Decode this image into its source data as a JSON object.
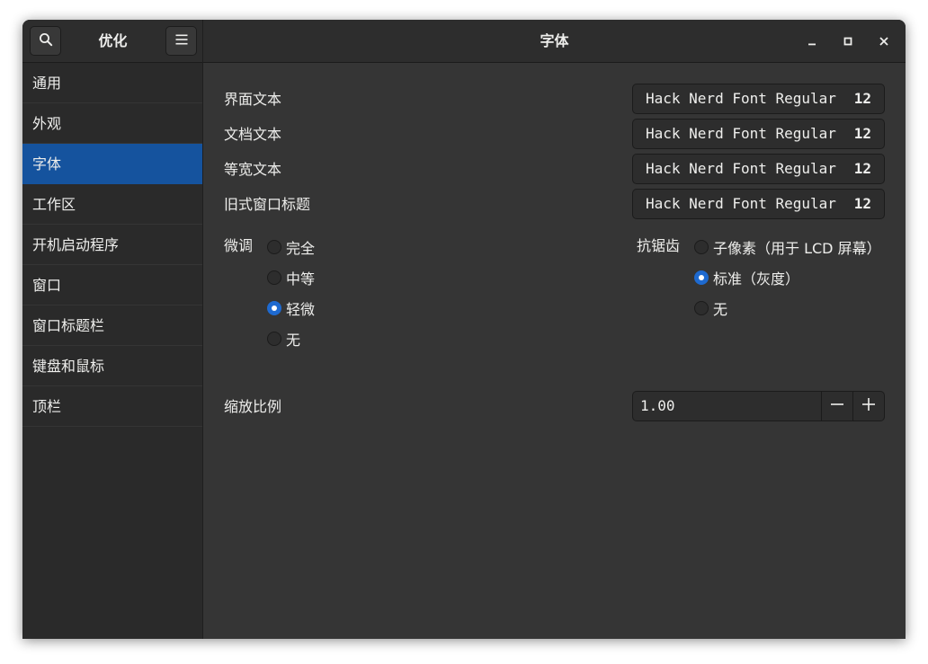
{
  "header": {
    "sidebar_title": "优化",
    "window_title": "字体"
  },
  "sidebar": {
    "items": [
      {
        "label": "通用"
      },
      {
        "label": "外观"
      },
      {
        "label": "字体",
        "selected": true
      },
      {
        "label": "工作区"
      },
      {
        "label": "开机启动程序"
      },
      {
        "label": "窗口"
      },
      {
        "label": "窗口标题栏"
      },
      {
        "label": "键盘和鼠标"
      },
      {
        "label": "顶栏"
      }
    ]
  },
  "fonts": [
    {
      "label": "界面文本",
      "font": "Hack Nerd Font Regular",
      "size": "12"
    },
    {
      "label": "文档文本",
      "font": "Hack Nerd Font Regular",
      "size": "12"
    },
    {
      "label": "等宽文本",
      "font": "Hack Nerd Font Regular",
      "size": "12"
    },
    {
      "label": "旧式窗口标题",
      "font": "Hack Nerd Font Regular",
      "size": "12"
    }
  ],
  "hinting": {
    "label": "微调",
    "options": [
      "完全",
      "中等",
      "轻微",
      "无"
    ],
    "selected": "轻微"
  },
  "antialiasing": {
    "label": "抗锯齿",
    "options": [
      "子像素（用于 LCD 屏幕）",
      "标准（灰度）",
      "无"
    ],
    "selected": "标准（灰度）"
  },
  "scaling": {
    "label": "缩放比例",
    "value": "1.00"
  },
  "colors": {
    "selection": "#15539e",
    "radio_checked": "#1e6ad0"
  },
  "icons": [
    "search-icon",
    "hamburger-menu-icon",
    "minimize-icon",
    "maximize-icon",
    "close-icon",
    "minus-icon",
    "plus-icon"
  ]
}
